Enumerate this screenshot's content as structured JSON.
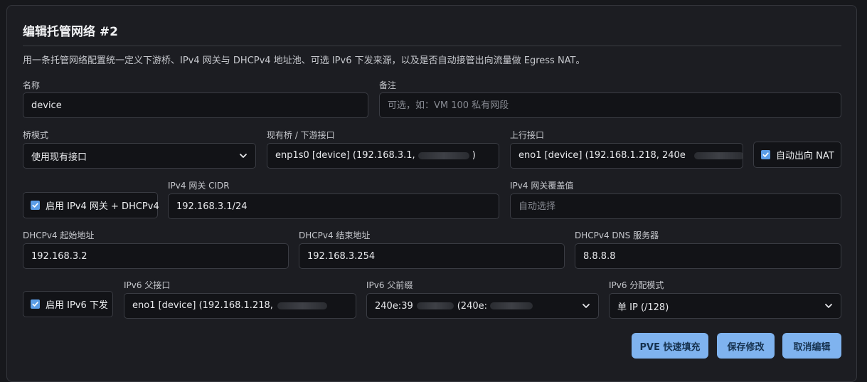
{
  "header": {
    "title": "编辑托管网络 #2",
    "description": "用一条托管网络配置统一定义下游桥、IPv4 网关与 DHCPv4 地址池、可选 IPv6 下发来源，以及是否自动接管出向流量做 Egress NAT。"
  },
  "fields": {
    "name": {
      "label": "名称",
      "value": "device"
    },
    "remark": {
      "label": "备注",
      "value": "",
      "placeholder": "可选，如：VM 100 私有网段"
    },
    "bridge_mode": {
      "label": "桥模式",
      "value": "使用现有接口"
    },
    "existing_bridge": {
      "label": "现有桥 / 下游接口",
      "value_prefix": "enp1s0 [device] (192.168.3.1,",
      "value_suffix": ")"
    },
    "uplink": {
      "label": "上行接口",
      "value_prefix": "eno1 [device] (192.168.1.218, 240e"
    },
    "auto_nat": {
      "label": "自动出向 NAT",
      "checked": true
    },
    "ipv4_gateway": {
      "label": "启用 IPv4 网关 + DHCPv4",
      "checked": true
    },
    "ipv4_cidr": {
      "label": "IPv4 网关 CIDR",
      "value": "192.168.3.1/24"
    },
    "ipv4_override": {
      "label": "IPv4 网关覆盖值",
      "value": "",
      "placeholder": "自动选择"
    },
    "dhcp_start": {
      "label": "DHCPv4 起始地址",
      "value": "192.168.3.2"
    },
    "dhcp_end": {
      "label": "DHCPv4 结束地址",
      "value": "192.168.3.254"
    },
    "dhcp_dns": {
      "label": "DHCPv4 DNS 服务器",
      "value": "8.8.8.8"
    },
    "ipv6_enable": {
      "label": "启用 IPv6 下发",
      "checked": true
    },
    "ipv6_parent_iface": {
      "label": "IPv6 父接口",
      "value_prefix": "eno1 [device] (192.168.1.218,"
    },
    "ipv6_parent_prefix": {
      "label": "IPv6 父前缀",
      "value_prefix": "240e:39",
      "value_mid": "(240e:"
    },
    "ipv6_mode": {
      "label": "IPv6 分配模式",
      "value": "单 IP (/128)"
    }
  },
  "buttons": {
    "pve_fill": "PVE 快速填充",
    "save": "保存修改",
    "cancel": "取消编辑"
  },
  "colors": {
    "accent": "#7fb3ef",
    "checkbox": "#5b9de6",
    "background": "#1c1d22",
    "field_bg": "#121317"
  },
  "icons": {
    "select_arrow": "chevron-down-icon",
    "checkbox_mark": "check-icon"
  }
}
